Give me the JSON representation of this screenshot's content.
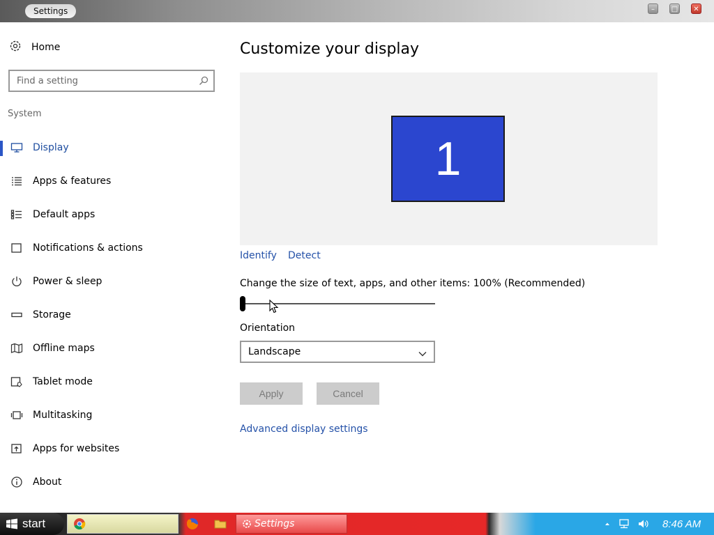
{
  "window": {
    "title": "Settings"
  },
  "sidebar": {
    "home_label": "Home",
    "search_placeholder": "Find a setting",
    "section": "System",
    "items": [
      {
        "label": "Display",
        "icon": "monitor-icon",
        "active": true
      },
      {
        "label": "Apps & features",
        "icon": "list-icon"
      },
      {
        "label": "Default apps",
        "icon": "list-check-icon"
      },
      {
        "label": "Notifications & actions",
        "icon": "notification-icon"
      },
      {
        "label": "Power & sleep",
        "icon": "power-icon"
      },
      {
        "label": "Storage",
        "icon": "storage-icon"
      },
      {
        "label": "Offline maps",
        "icon": "map-icon"
      },
      {
        "label": "Tablet mode",
        "icon": "tablet-icon"
      },
      {
        "label": "Multitasking",
        "icon": "multitask-icon"
      },
      {
        "label": "Apps for websites",
        "icon": "web-app-icon"
      },
      {
        "label": "About",
        "icon": "info-icon"
      }
    ]
  },
  "main": {
    "title": "Customize your display",
    "monitor_number": "1",
    "identify_label": "Identify",
    "detect_label": "Detect",
    "scale_label": "Change the size of text, apps, and other items: 100% (Recommended)",
    "scale_slider_value": 0,
    "orientation_label": "Orientation",
    "orientation_value": "Landscape",
    "apply_label": "Apply",
    "cancel_label": "Cancel",
    "advanced_link": "Advanced display settings"
  },
  "taskbar": {
    "start_label": "start",
    "active_task": "Settings",
    "clock": "8:46 AM"
  },
  "colors": {
    "accent": "#2b56c6",
    "link": "#2451a8",
    "monitor": "#2b46cf"
  }
}
